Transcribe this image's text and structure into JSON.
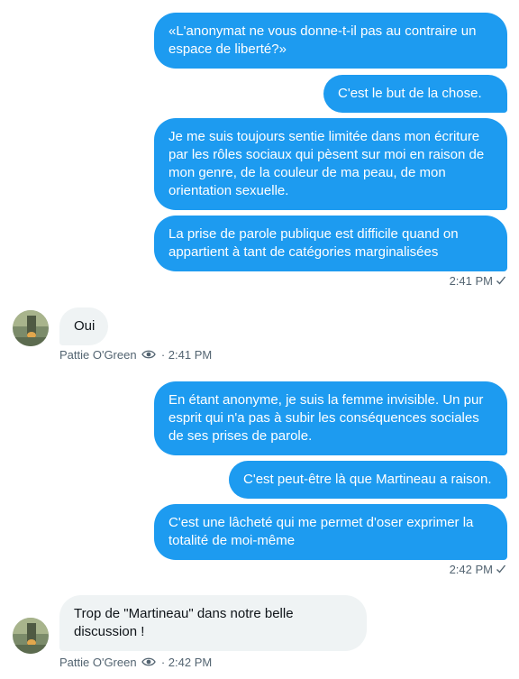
{
  "messages": {
    "m1": "«L'anonymat ne vous donne-t-il pas au contraire un espace de liberté?»",
    "m2": "C'est le but de la chose.",
    "m3": "Je me suis toujours sentie limitée dans mon écriture par les rôles sociaux qui pèsent sur moi en raison de mon genre, de la couleur de ma peau, de mon orientation sexuelle.",
    "m4": "La prise de parole publique est difficile quand on appartient à tant de catégories marginalisées",
    "m5": "Oui",
    "m6": "En étant anonyme, je suis la femme invisible. Un pur esprit qui n'a pas à subir les conséquences sociales de ses prises de parole.",
    "m7": "C'est peut-être là que Martineau a raison.",
    "m8": "C'est une lâcheté qui me permet d'oser exprimer la totalité de moi-même",
    "m9": "Trop de \"Martineau\" dans notre belle discussion !"
  },
  "meta": {
    "sent_time_1": "2:41 PM",
    "sender_name": "Pattie O'Green",
    "recv_time_1": "· 2:41 PM",
    "sent_time_2": "2:42 PM",
    "recv_time_2": "· 2:42 PM"
  },
  "colors": {
    "outgoing": "#1d9bf0",
    "incoming": "#eff3f4",
    "meta_text": "#536471"
  },
  "icons": [
    "check-icon",
    "eye-icon",
    "avatar-image"
  ]
}
